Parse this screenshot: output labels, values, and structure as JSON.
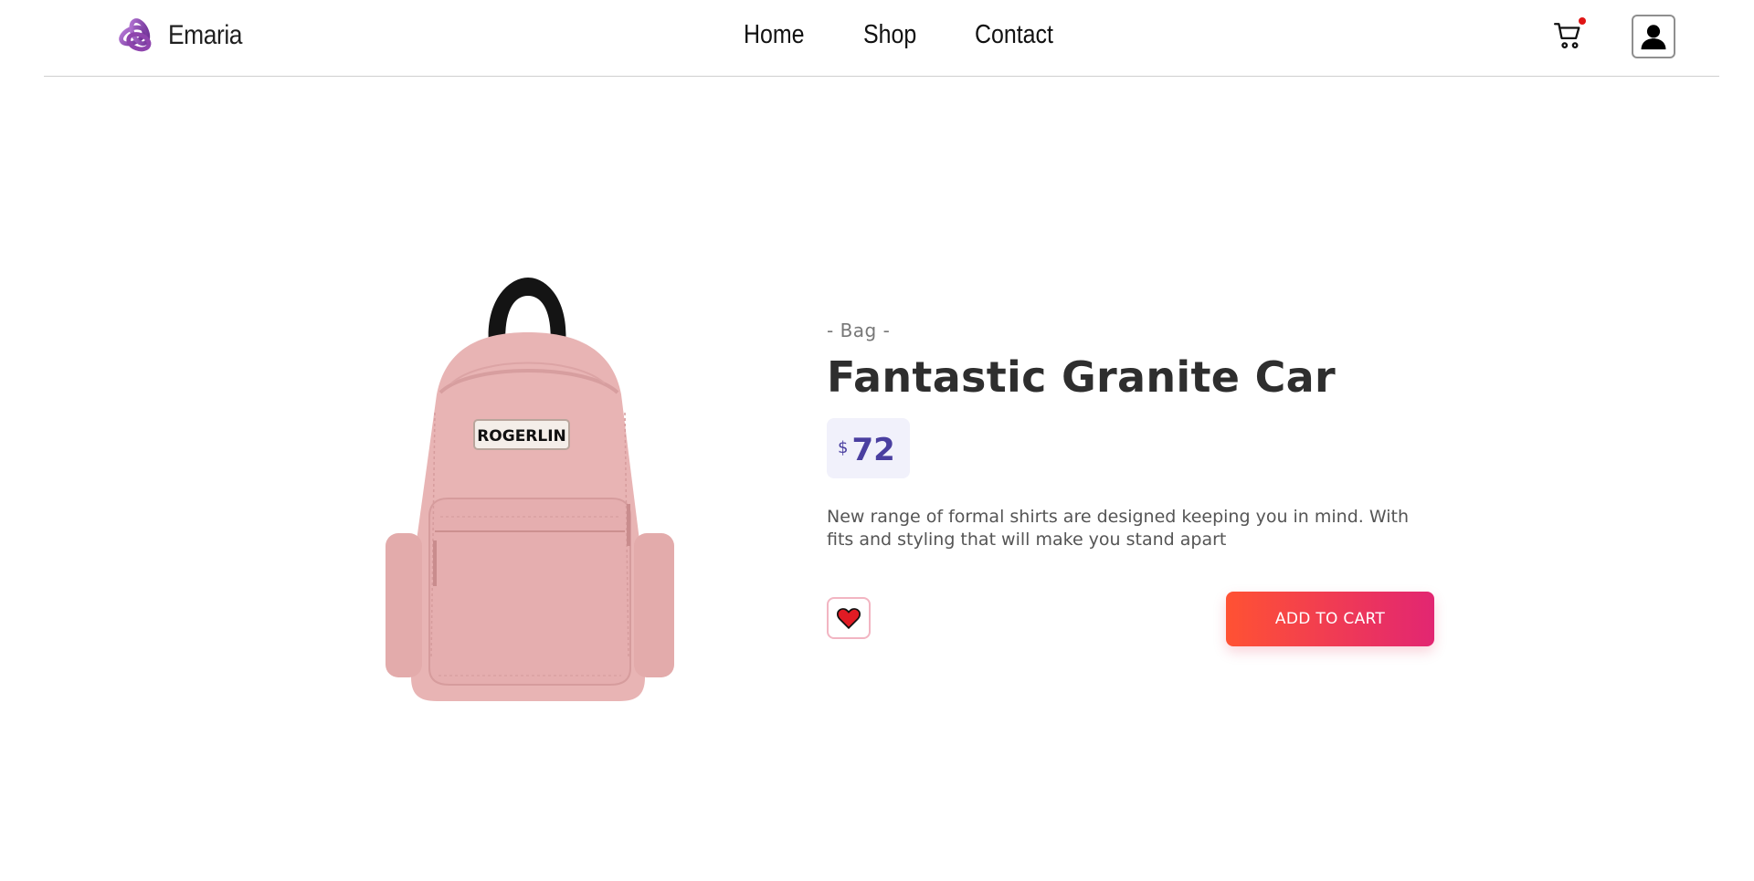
{
  "header": {
    "brand": "Emaria",
    "nav": [
      {
        "label": "Home"
      },
      {
        "label": "Shop"
      },
      {
        "label": "Contact"
      }
    ],
    "cart_icon": "cart-icon",
    "account_icon": "user-icon",
    "cart_has_notification": true
  },
  "product": {
    "category": "- Bag -",
    "title": "Fantastic Granite Car",
    "currency": "$",
    "price": "72",
    "description": "New range of formal shirts are designed keeping you in mind. With fits and styling that will make you stand apart",
    "badge_text": "ROGERLIN",
    "wishlist_icon": "heart-icon",
    "add_to_cart_label": "ADD TO CART"
  },
  "colors": {
    "brand_purple": "#8e44ad",
    "price_text": "#4a3fa0",
    "price_bg": "#f1f1fb",
    "button_gradient_start": "#ff5233",
    "button_gradient_end": "#e22672",
    "notification_dot": "#e01515",
    "backpack_pink": "#e8b4b4"
  }
}
